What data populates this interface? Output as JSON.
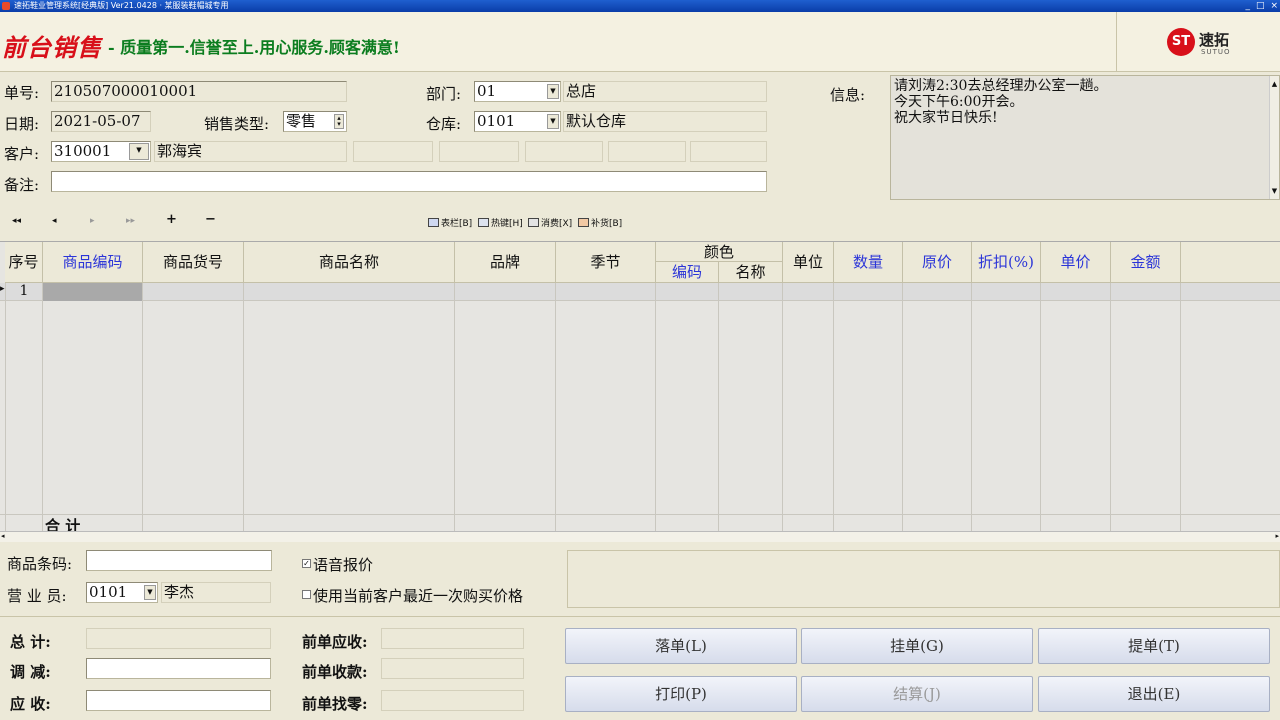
{
  "window": {
    "title": "速拓鞋业管理系统[经典版] Ver21.0428 · 某服装鞋帽城专用",
    "controls": [
      "_",
      "□",
      "×"
    ]
  },
  "header": {
    "heading": "前台销售",
    "slogan": "- 质量第一.信誉至上.用心服务.顾客满意!",
    "logo_mark": "ST",
    "logo_cn": "速拓",
    "logo_en": "SUTUO"
  },
  "form": {
    "order_no_label": "单号:",
    "order_no": "210507000010001",
    "date_label": "日期:",
    "date": "2021-05-07",
    "sale_type_label": "销售类型:",
    "sale_type": "零售",
    "customer_label": "客户:",
    "customer_code": "310001",
    "customer_name": "郭海宾",
    "remark_label": "备注:",
    "remark": "",
    "dept_label": "部门:",
    "dept_code": "01",
    "dept_name": "总店",
    "warehouse_label": "仓库:",
    "warehouse_code": "0101",
    "warehouse_name": "默认仓库",
    "info_label": "信息:",
    "info_lines": [
      "请刘涛2:30去总经理办公室一趟。",
      "今天下午6:00开会。",
      "祝大家节日快乐!"
    ]
  },
  "toolbar": {
    "first": "◂◂",
    "prev": "◂",
    "next": "▸",
    "last": "▸▸",
    "add": "+",
    "remove": "−",
    "columns": "表栏[B]",
    "hotkeys": "热键[H]",
    "consume": "消费[X]",
    "restock": "补货[B]"
  },
  "grid": {
    "headers": {
      "seq": "序号",
      "code": "商品编码",
      "item_no": "商品货号",
      "name": "商品名称",
      "brand": "品牌",
      "season": "季节",
      "color": "颜色",
      "color_code": "编码",
      "color_name": "名称",
      "unit": "单位",
      "qty": "数量",
      "orig_price": "原价",
      "discount": "折扣(%)",
      "price": "单价",
      "amount": "金额"
    },
    "rows": [
      {
        "seq": "1"
      }
    ],
    "total_label": "合  计"
  },
  "bottom": {
    "barcode_label": "商品条码:",
    "barcode": "",
    "clerk_label": "营 业 员:",
    "clerk_code": "0101",
    "clerk_name": "李杰",
    "voice_quote": "语音报价",
    "voice_quote_checked": true,
    "last_price": "使用当前客户最近一次购买价格",
    "last_price_checked": false,
    "total_label": "总    计:",
    "adjust_label": "调    减:",
    "receivable_label": "应    收:",
    "prev_receivable_label": "前单应收:",
    "prev_received_label": "前单收款:",
    "prev_change_label": "前单找零:"
  },
  "buttons": {
    "post": "落单(L)",
    "hold": "挂单(G)",
    "fetch": "提单(T)",
    "print": "打印(P)",
    "settle": "结算(J)",
    "exit": "退出(E)"
  }
}
